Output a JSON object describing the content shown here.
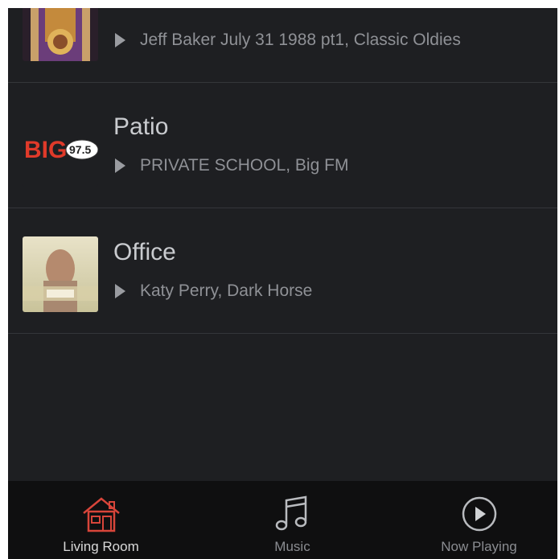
{
  "rooms": [
    {
      "name": "",
      "now_playing": "Jeff Baker July 31 1988 pt1, Classic Oldies",
      "art_icon": "jukebox-art"
    },
    {
      "name": "Patio",
      "now_playing": "PRIVATE SCHOOL, Big FM",
      "art_icon": "big-fm-logo",
      "logo_text": "BIG",
      "logo_sub": "97.5"
    },
    {
      "name": "Office",
      "now_playing": "Katy Perry, Dark Horse",
      "art_icon": "album-cover-art"
    }
  ],
  "tabs": [
    {
      "label": "Living Room",
      "icon": "house-icon",
      "active": true,
      "color": "#d8453a"
    },
    {
      "label": "Music",
      "icon": "music-note-icon",
      "active": false
    },
    {
      "label": "Now Playing",
      "icon": "play-circle-icon",
      "active": false
    }
  ]
}
